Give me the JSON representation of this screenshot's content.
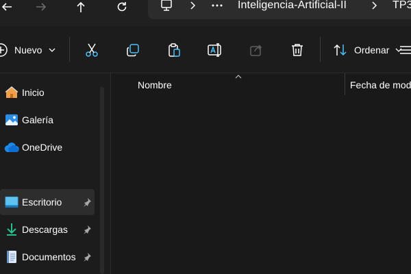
{
  "address": {
    "breadcrumbs": [
      "Inteligencia-Artificial-II",
      "TP3"
    ]
  },
  "commandbar": {
    "new_label": "Nuevo",
    "sort_label": "Ordenar"
  },
  "navigation": {
    "items": [
      {
        "label": "Inicio"
      },
      {
        "label": "Galería"
      },
      {
        "label": "OneDrive"
      },
      {
        "label": "Escritorio",
        "pinned": true
      },
      {
        "label": "Descargas",
        "pinned": true
      },
      {
        "label": "Documentos",
        "pinned": true
      }
    ]
  },
  "columns": {
    "name": "Nombre",
    "date": "Fecha de mod"
  },
  "colors": {
    "accent": "#4cc2ff",
    "folder_home": "#f0a04b",
    "onedrive": "#1e88e5"
  }
}
